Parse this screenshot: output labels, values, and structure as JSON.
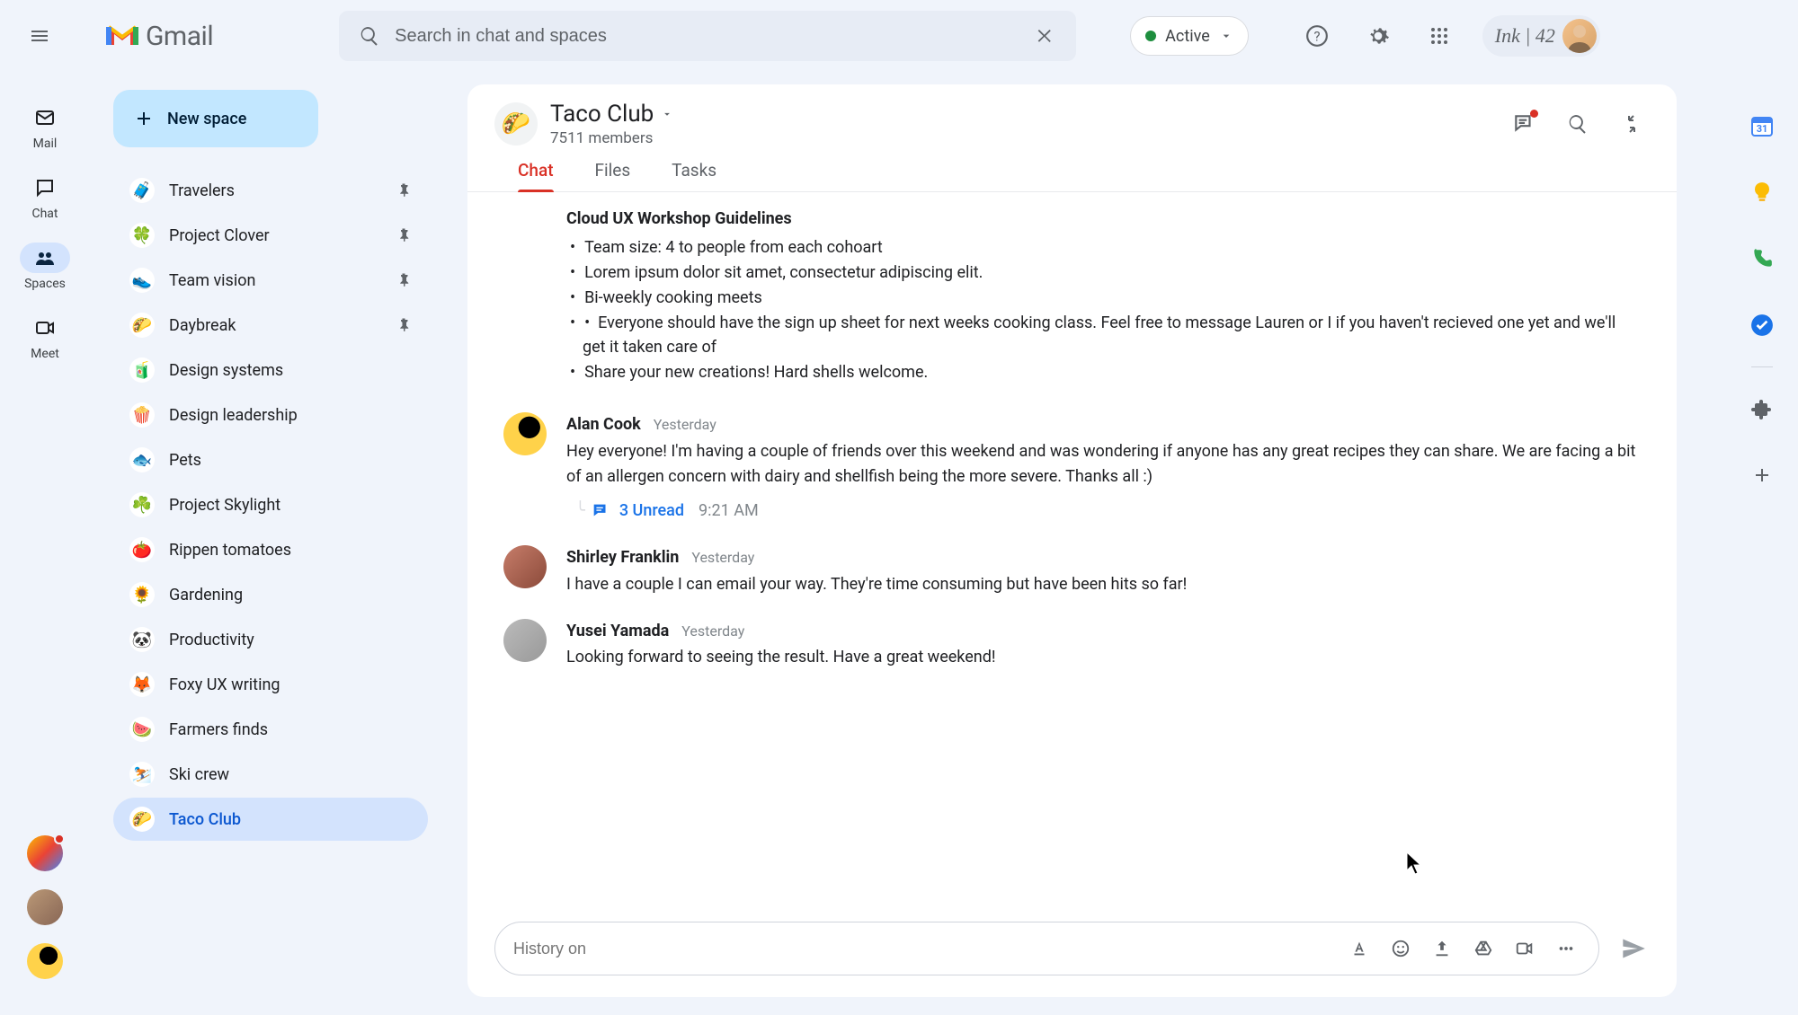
{
  "app_name": "Gmail",
  "search": {
    "placeholder": "Search in chat and spaces"
  },
  "status_label": "Active",
  "workspace_label": "Ink | 42",
  "mini_nav": [
    {
      "label": "Mail"
    },
    {
      "label": "Chat"
    },
    {
      "label": "Spaces"
    },
    {
      "label": "Meet"
    }
  ],
  "new_space_label": "New space",
  "spaces": [
    {
      "emoji": "🧳",
      "label": "Travelers",
      "pinned": true
    },
    {
      "emoji": "🍀",
      "label": "Project Clover",
      "pinned": true
    },
    {
      "emoji": "👟",
      "label": "Team vision",
      "pinned": true
    },
    {
      "emoji": "🌮",
      "label": "Daybreak",
      "pinned": true
    },
    {
      "emoji": "🧃",
      "label": "Design systems",
      "pinned": false
    },
    {
      "emoji": "🍿",
      "label": "Design leadership",
      "pinned": false
    },
    {
      "emoji": "🐟",
      "label": "Pets",
      "pinned": false
    },
    {
      "emoji": "☘️",
      "label": "Project Skylight",
      "pinned": false
    },
    {
      "emoji": "🍅",
      "label": "Rippen tomatoes",
      "pinned": false
    },
    {
      "emoji": "🌻",
      "label": "Gardening",
      "pinned": false
    },
    {
      "emoji": "🐼",
      "label": "Productivity",
      "pinned": false
    },
    {
      "emoji": "🦊",
      "label": "Foxy UX writing",
      "pinned": false
    },
    {
      "emoji": "🍉",
      "label": "Farmers finds",
      "pinned": false
    },
    {
      "emoji": "⛷️",
      "label": "Ski crew",
      "pinned": false
    },
    {
      "emoji": "🌮",
      "label": "Taco Club",
      "pinned": false,
      "active": true
    }
  ],
  "current_space": {
    "emoji": "🌮",
    "name": "Taco Club",
    "members": "7511 members"
  },
  "tabs": {
    "chat": "Chat",
    "files": "Files",
    "tasks": "Tasks"
  },
  "pinned": {
    "heading": "Cloud UX Workshop Guidelines",
    "lines": [
      "Team size: 4 to people from each cohoart",
      "Lorem ipsum dolor sit amet, consectetur adipiscing elit.",
      "Bi-weekly cooking meets",
      "Everyone should have the sign up sheet for next weeks cooking class. Feel free to message Lauren or I if you haven't recieved one yet and we'll get it taken care of",
      "Share your new creations! Hard shells welcome."
    ]
  },
  "messages": [
    {
      "name": "Alan Cook",
      "time": "Yesterday",
      "text": "Hey everyone! I'm having a couple of friends over this weekend and was wondering if anyone has any great recipes they can share. We are facing a bit of an allergen concern with dairy and shellfish being the more severe. Thanks all :)",
      "thread_label": "3 Unread",
      "thread_time": "9:21 AM"
    },
    {
      "name": "Shirley Franklin",
      "time": "Yesterday",
      "text": "I have a couple I can email your way. They're time consuming but have been hits so far!"
    },
    {
      "name": "Yusei Yamada",
      "time": "Yesterday",
      "text": "Looking forward to seeing the result. Have a great weekend!"
    }
  ],
  "composer_placeholder": "History on"
}
